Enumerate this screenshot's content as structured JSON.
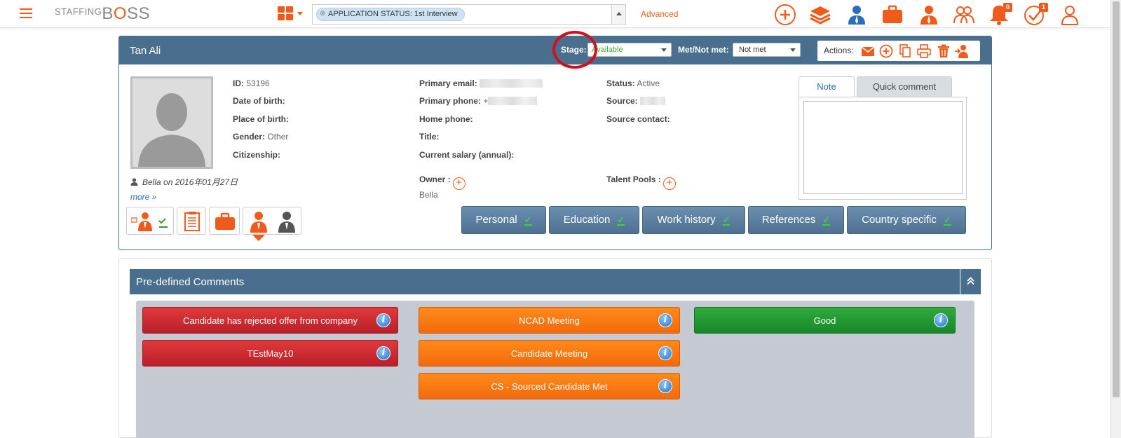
{
  "app": {
    "logo_text_small": "STAFFING",
    "logo_text_big_pre": "B",
    "logo_text_big_o": "O",
    "logo_text_big_post": "SS"
  },
  "search": {
    "tag_label": "APPLICATION STATUS: 1st Interview",
    "advanced_label": "Advanced"
  },
  "topnav": {
    "notifications_count": "0",
    "tasks_count": "1"
  },
  "candidate": {
    "name": "Tan Ali",
    "stage_label": "Stage:",
    "stage_value": "Available",
    "met_label": "Met/Not met:",
    "met_value": "Not met",
    "actions_label": "Actions:",
    "id_label": "ID:",
    "id_value": "53196",
    "dob_label": "Date of birth:",
    "pob_label": "Place of birth:",
    "gender_label": "Gender:",
    "gender_value": "Other",
    "citizenship_label": "Citizenship:",
    "email_label": "Primary email:",
    "phone_label": "Primary phone:",
    "phone_prefix": "+",
    "home_phone_label": "Home phone:",
    "title_label": "Title:",
    "salary_label": "Current salary (annual):",
    "status_label": "Status:",
    "status_value": "Active",
    "source_label": "Source:",
    "source_contact_label": "Source contact:",
    "owner_label": "Owner :",
    "owner_value": "Bella",
    "talent_pools_label": "Talent Pools :",
    "created_by": "Bella on 2016年01月27日",
    "more_link": "more »"
  },
  "note_tabs": {
    "note": "Note",
    "quick_comment": "Quick comment"
  },
  "sections": [
    "Personal",
    "Education",
    "Work history",
    "References",
    "Country specific"
  ],
  "comments": {
    "title": "Pre-defined Comments",
    "col1": [
      "Candidate has rejected offer from company",
      "TEstMay10"
    ],
    "col2": [
      "NCAD Meeting",
      "Candidate Meeting",
      "CS - Sourced Candidate Met"
    ],
    "col3": [
      "Good"
    ],
    "info_glyph": "i"
  },
  "colors": {
    "accent": "#f05a1a",
    "header_blue": "#4a6f8e",
    "red": "#c8282f",
    "orange": "#f7780f",
    "green": "#23993a"
  }
}
